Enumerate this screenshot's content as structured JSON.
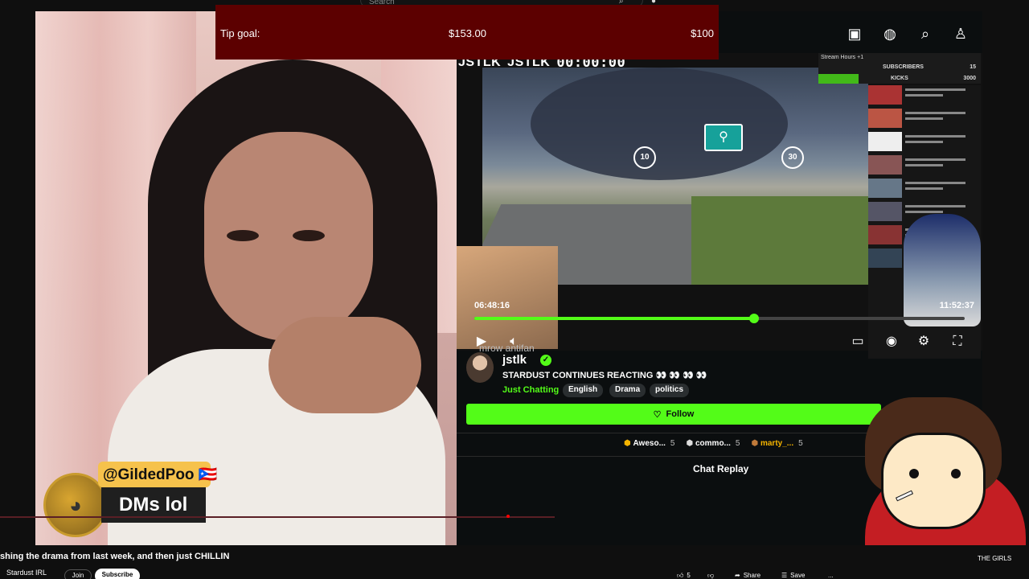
{
  "youtube": {
    "search_placeholder": "Search",
    "video_title": "shing the drama from last week, and then just CHILLIN",
    "channel_name": "Stardust IRL",
    "join_label": "Join",
    "subscribe_label": "Subscribe",
    "like_count": "5",
    "share_label": "Share",
    "save_label": "Save",
    "more_label": "...",
    "sidebar_title_fragment": "THE GIRLS"
  },
  "tip_goal": {
    "label": "Tip goal:",
    "current": "$153.00",
    "target": "$100",
    "background_color": "#5c0000"
  },
  "chat_badge": {
    "username": "@GildedPoo",
    "flag": "🇵🇷",
    "message": "DMs lol",
    "name_bg_color": "#f6c24c"
  },
  "kick": {
    "header_logos": [
      "JSTLK",
      "JSTLK"
    ],
    "timer": "00:00:00",
    "top_icons": [
      "video-icon",
      "globe-icon",
      "search-icon",
      "user-icon"
    ],
    "overlay_stats": {
      "stream_hours": "Stream Hours +1",
      "subscribers_label": "SUBSCRIBERS",
      "subscribers_count": "15",
      "kicks_label": "KICKS",
      "kicks_count": "3000"
    },
    "inner_caption": "mrow antifan",
    "skip_back": "10",
    "skip_forward": "30",
    "time_elapsed": "06:48:16",
    "time_total": "11:52:37",
    "progress_fraction": 0.57,
    "channel": {
      "name": "jstlk",
      "verified": true,
      "stream_title": "STARDUST CONTINUES REACTING 👀 👀 👀 👀",
      "category": "Just Chatting",
      "tags": [
        "English",
        "Drama",
        "politics"
      ]
    },
    "follow_label": "Follow",
    "top_gifters": [
      {
        "name": "Aweso...",
        "count": "5"
      },
      {
        "name": "commo...",
        "count": "5"
      },
      {
        "name": "marty_...",
        "count": "5"
      }
    ],
    "chat_replay_label": "Chat Replay",
    "accent_color": "#53fc18"
  }
}
